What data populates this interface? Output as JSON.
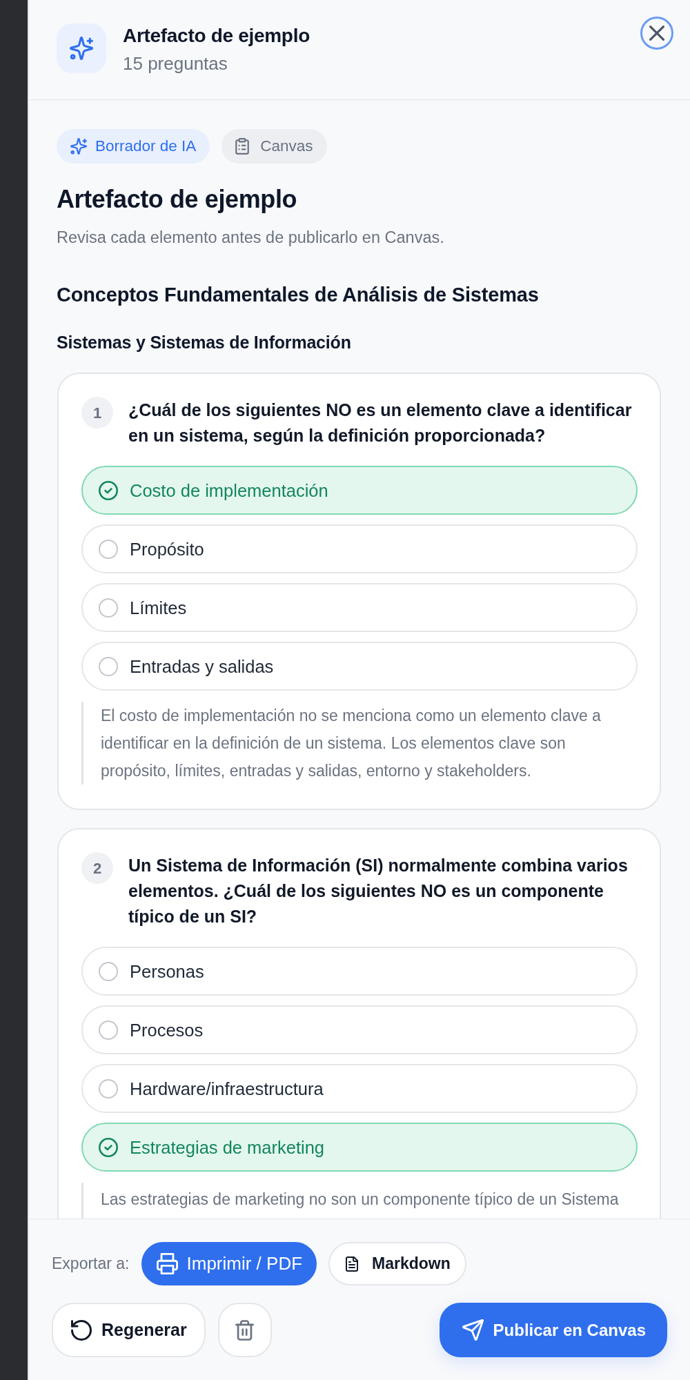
{
  "header": {
    "title": "Artefacto de ejemplo",
    "subtitle": "15 preguntas"
  },
  "tags": [
    {
      "label": "Borrador de IA",
      "kind": "draft"
    },
    {
      "label": "Canvas",
      "kind": "platform"
    }
  ],
  "artifact": {
    "title": "Artefacto de ejemplo",
    "description": "Revisa cada elemento antes de publicarlo en Canvas."
  },
  "section": {
    "title": "Conceptos Fundamentales de Análisis de Sistemas",
    "subtitle": "Sistemas y Sistemas de Información"
  },
  "questions": [
    {
      "number": "1",
      "text": "¿Cuál de los siguientes NO es un elemento clave a identificar en un sistema, según la definición proporcionada?",
      "options": [
        {
          "label": "Costo de implementación",
          "correct": true
        },
        {
          "label": "Propósito",
          "correct": false
        },
        {
          "label": "Límites",
          "correct": false
        },
        {
          "label": "Entradas y salidas",
          "correct": false
        }
      ],
      "explanation": "El costo de implementación no se menciona como un elemento clave a identificar en la definición de un sistema. Los elementos clave son propósito, límites, entradas y salidas, entorno y stakeholders."
    },
    {
      "number": "2",
      "text": "Un Sistema de Información (SI) normalmente combina varios elementos. ¿Cuál de los siguientes NO es un componente típico de un SI?",
      "options": [
        {
          "label": "Personas",
          "correct": false
        },
        {
          "label": "Procesos",
          "correct": false
        },
        {
          "label": "Hardware/infraestructura",
          "correct": false
        },
        {
          "label": "Estrategias de marketing",
          "correct": true
        }
      ],
      "explanation": "Las estrategias de marketing no son un componente típico de un Sistema"
    }
  ],
  "export": {
    "label": "Exportar a:",
    "formats": [
      {
        "label": "Imprimir / PDF",
        "kind": "print",
        "primary": true
      },
      {
        "label": "Markdown",
        "kind": "markdown",
        "primary": false
      }
    ]
  },
  "actions": {
    "regenerate": "Regenerar",
    "publish": "Publicar en Canvas"
  }
}
